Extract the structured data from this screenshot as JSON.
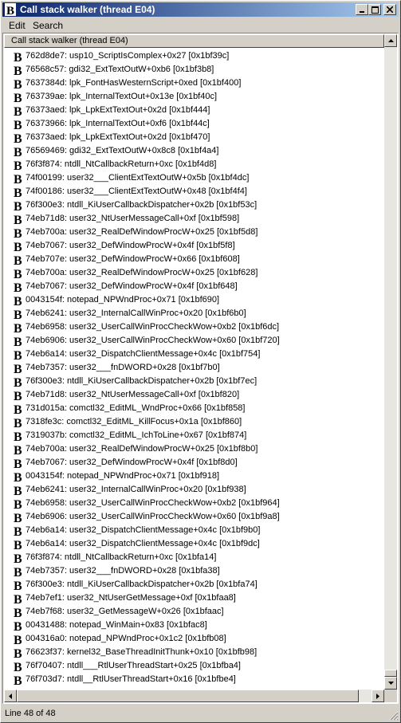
{
  "window": {
    "title": "Call stack walker (thread E04)"
  },
  "menu": [
    "Edit",
    "Search"
  ],
  "list": {
    "header": "Call stack walker (thread E04)",
    "selected_index": 47,
    "rows": [
      "762d8de7: usp10_ScriptIsComplex+0x27 [0x1bf39c]",
      "76568c57: gdi32_ExtTextOutW+0xb6 [0x1bf3b8]",
      "7637384d: lpk_FontHasWesternScript+0xed [0x1bf400]",
      "763739ae: lpk_InternalTextOut+0x13e [0x1bf40c]",
      "76373aed: lpk_LpkExtTextOut+0x2d [0x1bf444]",
      "76373966: lpk_InternalTextOut+0xf6 [0x1bf44c]",
      "76373aed: lpk_LpkExtTextOut+0x2d [0x1bf470]",
      "76569469: gdi32_ExtTextOutW+0x8c8 [0x1bf4a4]",
      "76f3f874: ntdll_NtCallbackReturn+0xc [0x1bf4d8]",
      "74f00199: user32___ClientExtTextOutW+0x5b [0x1bf4dc]",
      "74f00186: user32___ClientExtTextOutW+0x48 [0x1bf4f4]",
      "76f300e3: ntdll_KiUserCallbackDispatcher+0x2b [0x1bf53c]",
      "74eb71d8: user32_NtUserMessageCall+0xf [0x1bf598]",
      "74eb700a: user32_RealDefWindowProcW+0x25 [0x1bf5d8]",
      "74eb7067: user32_DefWindowProcW+0x4f [0x1bf5f8]",
      "74eb707e: user32_DefWindowProcW+0x66 [0x1bf608]",
      "74eb700a: user32_RealDefWindowProcW+0x25 [0x1bf628]",
      "74eb7067: user32_DefWindowProcW+0x4f [0x1bf648]",
      "0043154f: notepad_NPWndProc+0x71 [0x1bf690]",
      "74eb6241: user32_InternalCallWinProc+0x20 [0x1bf6b0]",
      "74eb6958: user32_UserCallWinProcCheckWow+0xb2 [0x1bf6dc]",
      "74eb6906: user32_UserCallWinProcCheckWow+0x60 [0x1bf720]",
      "74eb6a14: user32_DispatchClientMessage+0x4c [0x1bf754]",
      "74eb7357: user32___fnDWORD+0x28 [0x1bf7b0]",
      "76f300e3: ntdll_KiUserCallbackDispatcher+0x2b [0x1bf7ec]",
      "74eb71d8: user32_NtUserMessageCall+0xf [0x1bf820]",
      "731d015a: comctl32_EditML_WndProc+0x66 [0x1bf858]",
      "7318fe3c: comctl32_EditML_KillFocus+0x1a [0x1bf860]",
      "7319037b: comctl32_EditML_IchToLine+0x67 [0x1bf874]",
      "74eb700a: user32_RealDefWindowProcW+0x25 [0x1bf8b0]",
      "74eb7067: user32_DefWindowProcW+0x4f [0x1bf8d0]",
      "0043154f: notepad_NPWndProc+0x71 [0x1bf918]",
      "74eb6241: user32_InternalCallWinProc+0x20 [0x1bf938]",
      "74eb6958: user32_UserCallWinProcCheckWow+0xb2 [0x1bf964]",
      "74eb6906: user32_UserCallWinProcCheckWow+0x60 [0x1bf9a8]",
      "74eb6a14: user32_DispatchClientMessage+0x4c [0x1bf9b0]",
      "74eb6a14: user32_DispatchClientMessage+0x4c [0x1bf9dc]",
      "76f3f874: ntdll_NtCallbackReturn+0xc [0x1bfa14]",
      "74eb7357: user32___fnDWORD+0x28 [0x1bfa38]",
      "76f300e3: ntdll_KiUserCallbackDispatcher+0x2b [0x1bfa74]",
      "74eb7ef1: user32_NtUserGetMessage+0xf [0x1bfaa8]",
      "74eb7f68: user32_GetMessageW+0x26 [0x1bfaac]",
      "00431488: notepad_WinMain+0x83 [0x1bfac8]",
      "004316a0: notepad_NPWndProc+0x1c2 [0x1bfb08]",
      "76623f37: kernel32_BaseThreadInitThunk+0x10 [0x1bfb98]",
      "76f70407: ntdll___RtlUserThreadStart+0x25 [0x1bfba4]",
      "76f703d7: ntdll__RtlUserThreadStart+0x16 [0x1bfbe4]"
    ]
  },
  "status": {
    "text": "Line 48 of 48"
  },
  "icons": {
    "row_icon": "b-frame-icon"
  }
}
